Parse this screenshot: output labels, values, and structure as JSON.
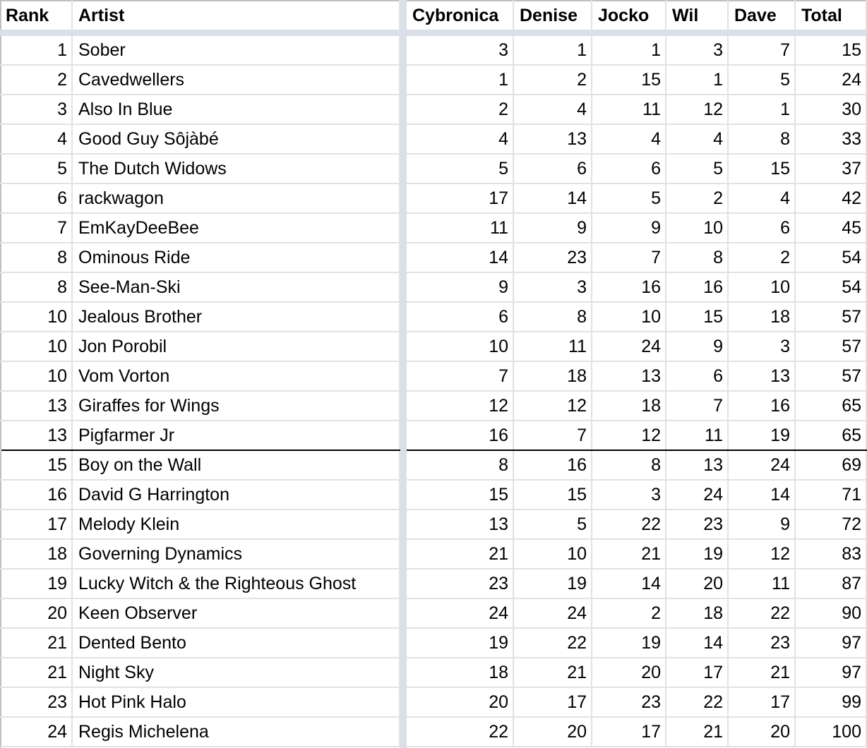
{
  "headers": {
    "rank": "Rank",
    "artist": "Artist",
    "cybronica": "Cybronica",
    "denise": "Denise",
    "jocko": "Jocko",
    "wil": "Wil",
    "dave": "Dave",
    "total": "Total"
  },
  "cutoff_after_row": 14,
  "rows": [
    {
      "rank": "1",
      "artist": "Sober",
      "cybronica": "3",
      "denise": "1",
      "jocko": "1",
      "wil": "3",
      "dave": "7",
      "total": "15"
    },
    {
      "rank": "2",
      "artist": "Cavedwellers",
      "cybronica": "1",
      "denise": "2",
      "jocko": "15",
      "wil": "1",
      "dave": "5",
      "total": "24"
    },
    {
      "rank": "3",
      "artist": "Also In Blue",
      "cybronica": "2",
      "denise": "4",
      "jocko": "11",
      "wil": "12",
      "dave": "1",
      "total": "30"
    },
    {
      "rank": "4",
      "artist": "Good Guy Sôjàbé",
      "cybronica": "4",
      "denise": "13",
      "jocko": "4",
      "wil": "4",
      "dave": "8",
      "total": "33"
    },
    {
      "rank": "5",
      "artist": "The Dutch Widows",
      "cybronica": "5",
      "denise": "6",
      "jocko": "6",
      "wil": "5",
      "dave": "15",
      "total": "37"
    },
    {
      "rank": "6",
      "artist": "rackwagon",
      "cybronica": "17",
      "denise": "14",
      "jocko": "5",
      "wil": "2",
      "dave": "4",
      "total": "42"
    },
    {
      "rank": "7",
      "artist": "EmKayDeeBee",
      "cybronica": "11",
      "denise": "9",
      "jocko": "9",
      "wil": "10",
      "dave": "6",
      "total": "45"
    },
    {
      "rank": "8",
      "artist": "Ominous Ride",
      "cybronica": "14",
      "denise": "23",
      "jocko": "7",
      "wil": "8",
      "dave": "2",
      "total": "54"
    },
    {
      "rank": "8",
      "artist": "See-Man-Ski",
      "cybronica": "9",
      "denise": "3",
      "jocko": "16",
      "wil": "16",
      "dave": "10",
      "total": "54"
    },
    {
      "rank": "10",
      "artist": "Jealous Brother",
      "cybronica": "6",
      "denise": "8",
      "jocko": "10",
      "wil": "15",
      "dave": "18",
      "total": "57"
    },
    {
      "rank": "10",
      "artist": "Jon Porobil",
      "cybronica": "10",
      "denise": "11",
      "jocko": "24",
      "wil": "9",
      "dave": "3",
      "total": "57"
    },
    {
      "rank": "10",
      "artist": "Vom Vorton",
      "cybronica": "7",
      "denise": "18",
      "jocko": "13",
      "wil": "6",
      "dave": "13",
      "total": "57"
    },
    {
      "rank": "13",
      "artist": "Giraffes for Wings",
      "cybronica": "12",
      "denise": "12",
      "jocko": "18",
      "wil": "7",
      "dave": "16",
      "total": "65"
    },
    {
      "rank": "13",
      "artist": "Pigfarmer Jr",
      "cybronica": "16",
      "denise": "7",
      "jocko": "12",
      "wil": "11",
      "dave": "19",
      "total": "65"
    },
    {
      "rank": "15",
      "artist": "Boy on the Wall",
      "cybronica": "8",
      "denise": "16",
      "jocko": "8",
      "wil": "13",
      "dave": "24",
      "total": "69"
    },
    {
      "rank": "16",
      "artist": "David G Harrington",
      "cybronica": "15",
      "denise": "15",
      "jocko": "3",
      "wil": "24",
      "dave": "14",
      "total": "71"
    },
    {
      "rank": "17",
      "artist": "Melody Klein",
      "cybronica": "13",
      "denise": "5",
      "jocko": "22",
      "wil": "23",
      "dave": "9",
      "total": "72"
    },
    {
      "rank": "18",
      "artist": "Governing Dynamics",
      "cybronica": "21",
      "denise": "10",
      "jocko": "21",
      "wil": "19",
      "dave": "12",
      "total": "83"
    },
    {
      "rank": "19",
      "artist": "Lucky Witch & the Righteous Ghost",
      "cybronica": "23",
      "denise": "19",
      "jocko": "14",
      "wil": "20",
      "dave": "11",
      "total": "87"
    },
    {
      "rank": "20",
      "artist": "Keen Observer",
      "cybronica": "24",
      "denise": "24",
      "jocko": "2",
      "wil": "18",
      "dave": "22",
      "total": "90"
    },
    {
      "rank": "21",
      "artist": "Dented Bento",
      "cybronica": "19",
      "denise": "22",
      "jocko": "19",
      "wil": "14",
      "dave": "23",
      "total": "97"
    },
    {
      "rank": "21",
      "artist": "Night Sky",
      "cybronica": "18",
      "denise": "21",
      "jocko": "20",
      "wil": "17",
      "dave": "21",
      "total": "97"
    },
    {
      "rank": "23",
      "artist": "Hot Pink Halo",
      "cybronica": "20",
      "denise": "17",
      "jocko": "23",
      "wil": "22",
      "dave": "17",
      "total": "99"
    },
    {
      "rank": "24",
      "artist": "Regis Michelena",
      "cybronica": "22",
      "denise": "20",
      "jocko": "17",
      "wil": "21",
      "dave": "20",
      "total": "100"
    }
  ]
}
